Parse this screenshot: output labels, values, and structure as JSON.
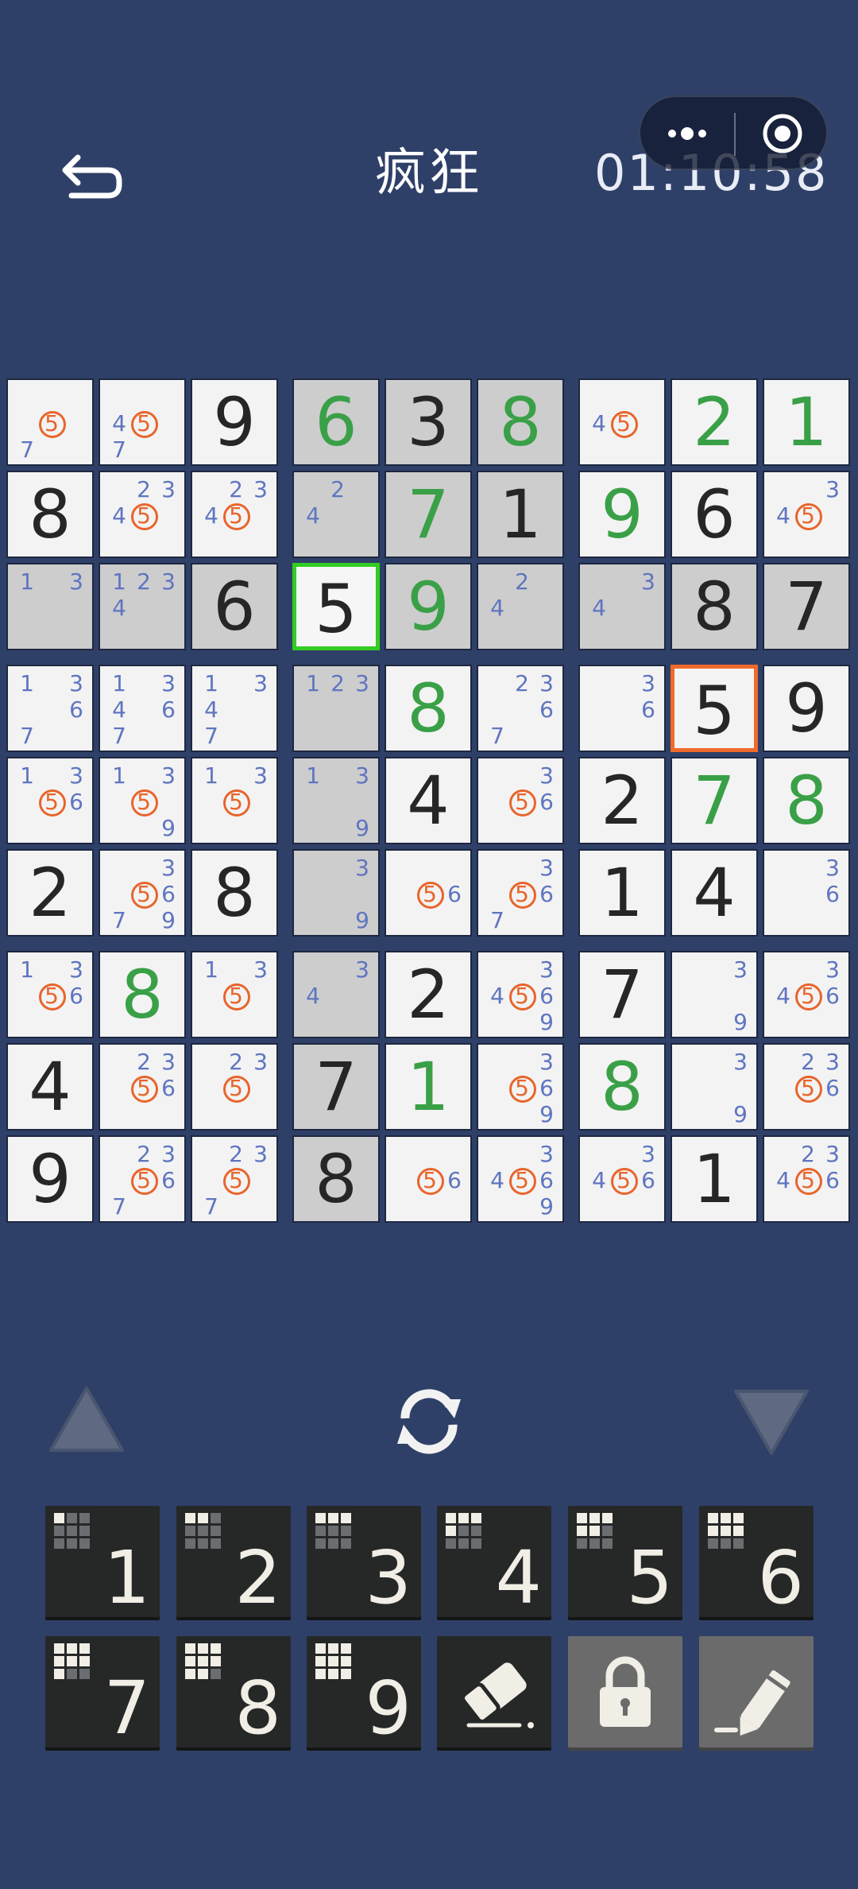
{
  "header": {
    "title": "疯狂",
    "timer": "01:10:58"
  },
  "icons": {
    "back": "back-arrow-icon",
    "more": "more-dots-icon",
    "target": "target-icon",
    "refresh": "refresh-icon",
    "prev": "triangle-up-icon",
    "next": "triangle-down-icon",
    "erase": "eraser-icon",
    "lock": "lock-icon",
    "pencil": "pencil-icon"
  },
  "colors": {
    "background": "#2f4068",
    "given": "#3aa047",
    "user": "#262626",
    "note": "#5f75c0",
    "noteHighlight": "#e8652c",
    "selected": "#33cc22",
    "conflict": "#ef6a2b",
    "highlightCell": "#cdcdcd"
  },
  "board": {
    "selected": [
      2,
      3
    ],
    "conflict": [
      3,
      7
    ],
    "highlighted": [
      [
        0,
        3
      ],
      [
        0,
        4
      ],
      [
        0,
        5
      ],
      [
        1,
        3
      ],
      [
        1,
        4
      ],
      [
        1,
        5
      ],
      [
        2,
        0
      ],
      [
        2,
        1
      ],
      [
        2,
        2
      ],
      [
        2,
        4
      ],
      [
        2,
        5
      ],
      [
        2,
        6
      ],
      [
        2,
        7
      ],
      [
        2,
        8
      ],
      [
        3,
        3
      ],
      [
        4,
        3
      ],
      [
        5,
        3
      ],
      [
        6,
        3
      ],
      [
        7,
        3
      ],
      [
        8,
        3
      ]
    ],
    "highlight_note": "5",
    "cells": [
      [
        {
          "n": [
            "5",
            "7"
          ]
        },
        {
          "n": [
            "4",
            "5",
            "7"
          ]
        },
        {
          "v": "9"
        },
        {
          "v": "6",
          "g": true
        },
        {
          "v": "3"
        },
        {
          "v": "8",
          "g": true
        },
        {
          "n": [
            "4",
            "5"
          ]
        },
        {
          "v": "2",
          "g": true
        },
        {
          "v": "1",
          "g": true
        }
      ],
      [
        {
          "v": "8"
        },
        {
          "n": [
            "2",
            "3",
            "4",
            "5"
          ]
        },
        {
          "n": [
            "2",
            "3",
            "4",
            "5"
          ]
        },
        {
          "n": [
            "2",
            "4"
          ]
        },
        {
          "v": "7",
          "g": true
        },
        {
          "v": "1"
        },
        {
          "v": "9",
          "g": true
        },
        {
          "v": "6"
        },
        {
          "n": [
            "3",
            "4",
            "5"
          ]
        }
      ],
      [
        {
          "n": [
            "1",
            "3"
          ]
        },
        {
          "n": [
            "1",
            "2",
            "3",
            "4"
          ]
        },
        {
          "v": "6"
        },
        {
          "v": "5"
        },
        {
          "v": "9",
          "g": true
        },
        {
          "n": [
            "2",
            "4"
          ]
        },
        {
          "n": [
            "3",
            "4"
          ]
        },
        {
          "v": "8"
        },
        {
          "v": "7"
        }
      ],
      [
        {
          "n": [
            "1",
            "3",
            "6",
            "7"
          ]
        },
        {
          "n": [
            "1",
            "3",
            "4",
            "6",
            "7"
          ]
        },
        {
          "n": [
            "1",
            "3",
            "4",
            "7"
          ]
        },
        {
          "n": [
            "1",
            "2",
            "3"
          ]
        },
        {
          "v": "8",
          "g": true
        },
        {
          "n": [
            "2",
            "3",
            "6",
            "7"
          ]
        },
        {
          "n": [
            "3",
            "6"
          ]
        },
        {
          "v": "5"
        },
        {
          "v": "9"
        }
      ],
      [
        {
          "n": [
            "1",
            "3",
            "5",
            "6"
          ]
        },
        {
          "n": [
            "1",
            "3",
            "5",
            "9"
          ]
        },
        {
          "n": [
            "1",
            "3",
            "5"
          ]
        },
        {
          "n": [
            "1",
            "3",
            "9"
          ]
        },
        {
          "v": "4"
        },
        {
          "n": [
            "3",
            "5",
            "6"
          ]
        },
        {
          "v": "2"
        },
        {
          "v": "7",
          "g": true
        },
        {
          "v": "8",
          "g": true
        }
      ],
      [
        {
          "v": "2"
        },
        {
          "n": [
            "3",
            "5",
            "6",
            "7",
            "9"
          ]
        },
        {
          "v": "8"
        },
        {
          "n": [
            "3",
            "9"
          ]
        },
        {
          "n": [
            "5",
            "6"
          ]
        },
        {
          "n": [
            "3",
            "5",
            "6",
            "7"
          ]
        },
        {
          "v": "1"
        },
        {
          "v": "4"
        },
        {
          "n": [
            "3",
            "6"
          ]
        }
      ],
      [
        {
          "n": [
            "1",
            "3",
            "5",
            "6"
          ]
        },
        {
          "v": "8",
          "g": true
        },
        {
          "n": [
            "1",
            "3",
            "5"
          ]
        },
        {
          "n": [
            "3",
            "4"
          ]
        },
        {
          "v": "2"
        },
        {
          "n": [
            "3",
            "4",
            "5",
            "6",
            "9"
          ]
        },
        {
          "v": "7"
        },
        {
          "n": [
            "3",
            "9"
          ]
        },
        {
          "n": [
            "3",
            "4",
            "5",
            "6"
          ]
        }
      ],
      [
        {
          "v": "4"
        },
        {
          "n": [
            "2",
            "3",
            "5",
            "6"
          ]
        },
        {
          "n": [
            "2",
            "3",
            "5"
          ]
        },
        {
          "v": "7"
        },
        {
          "v": "1",
          "g": true
        },
        {
          "n": [
            "3",
            "5",
            "6",
            "9"
          ]
        },
        {
          "v": "8",
          "g": true
        },
        {
          "n": [
            "3",
            "9"
          ]
        },
        {
          "n": [
            "2",
            "3",
            "5",
            "6"
          ]
        }
      ],
      [
        {
          "v": "9"
        },
        {
          "n": [
            "2",
            "3",
            "5",
            "6",
            "7"
          ]
        },
        {
          "n": [
            "2",
            "3",
            "5",
            "7"
          ]
        },
        {
          "v": "8"
        },
        {
          "n": [
            "5",
            "6"
          ]
        },
        {
          "n": [
            "3",
            "4",
            "5",
            "6",
            "9"
          ]
        },
        {
          "n": [
            "3",
            "4",
            "5",
            "6"
          ]
        },
        {
          "v": "1"
        },
        {
          "n": [
            "2",
            "3",
            "4",
            "5",
            "6"
          ]
        }
      ]
    ]
  },
  "keypad": [
    {
      "label": "1",
      "icon": "mini-grid-icon",
      "count": 1
    },
    {
      "label": "2",
      "icon": "mini-grid-icon",
      "count": 2
    },
    {
      "label": "3",
      "icon": "mini-grid-icon",
      "count": 3
    },
    {
      "label": "4",
      "icon": "mini-grid-icon",
      "count": 4
    },
    {
      "label": "5",
      "icon": "mini-grid-icon",
      "count": 5
    },
    {
      "label": "6",
      "icon": "mini-grid-icon",
      "count": 6
    },
    {
      "label": "7",
      "icon": "mini-grid-icon",
      "count": 7
    },
    {
      "label": "8",
      "icon": "mini-grid-icon",
      "count": 8
    },
    {
      "label": "9",
      "icon": "mini-grid-icon",
      "count": 9
    }
  ]
}
